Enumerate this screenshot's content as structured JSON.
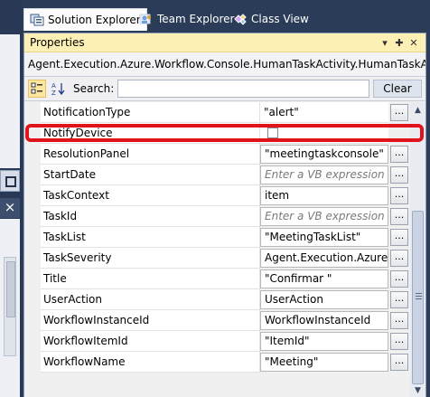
{
  "tabs": [
    {
      "label": "Solution Explorer",
      "icon": "solution-explorer-icon",
      "active": true
    },
    {
      "label": "Team Explorer",
      "icon": "team-explorer-icon",
      "active": false
    },
    {
      "label": "Class View",
      "icon": "class-view-icon",
      "active": false
    }
  ],
  "properties": {
    "title": "Properties",
    "pin_glyph": "▾ ✚ ✕",
    "object_name": "Agent.Execution.Azure.Workflow.Console.HumanTaskActivity.HumanTaskActivity",
    "search_label": "Search:",
    "search_value": "",
    "clear_label": "Clear",
    "more_label": "...",
    "rows": [
      {
        "name": "NotificationType",
        "value": "\"alert\"",
        "style": "plain",
        "has_button": true
      },
      {
        "name": "NotifyDevice",
        "value": "",
        "style": "checkbox",
        "has_button": false
      },
      {
        "name": "ResolutionPanel",
        "value": "\"meetingtaskconsole\"",
        "style": "box",
        "has_button": true
      },
      {
        "name": "StartDate",
        "value": "Enter a VB expression",
        "style": "hint",
        "has_button": true
      },
      {
        "name": "TaskContext",
        "value": "item",
        "style": "box",
        "has_button": true
      },
      {
        "name": "TaskId",
        "value": "Enter a VB expression",
        "style": "hint",
        "has_button": true
      },
      {
        "name": "TaskList",
        "value": "\"MeetingTaskList\"",
        "style": "box",
        "has_button": true
      },
      {
        "name": "TaskSeverity",
        "value": "Agent.Execution.Azure.W",
        "style": "box",
        "has_button": true
      },
      {
        "name": "Title",
        "value": "\"Confirmar \"",
        "style": "box",
        "has_button": true
      },
      {
        "name": "UserAction",
        "value": "UserAction",
        "style": "box",
        "has_button": true
      },
      {
        "name": "WorkflowInstanceId",
        "value": "WorkflowInstanceId",
        "style": "box",
        "has_button": true
      },
      {
        "name": "WorkflowItemId",
        "value": "\"ItemId\"",
        "style": "box",
        "has_button": true
      },
      {
        "name": "WorkflowName",
        "value": "\"Meeting\"",
        "style": "box",
        "has_button": true
      }
    ]
  },
  "colors": {
    "title_bar": "#fdf0b4",
    "highlight": "#e0121b",
    "chrome": "#2b3c59"
  }
}
